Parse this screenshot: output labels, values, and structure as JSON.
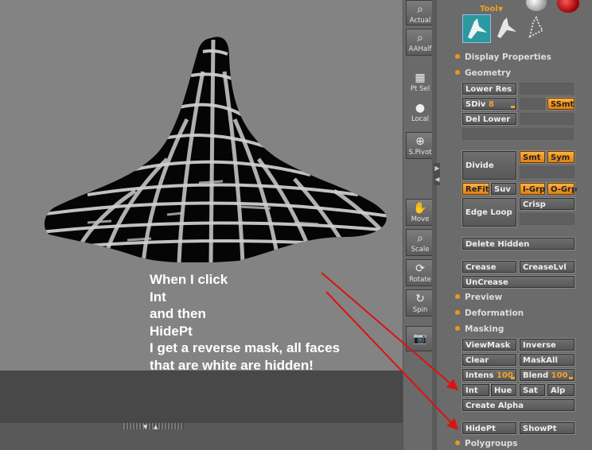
{
  "toolbar": {
    "items": [
      {
        "label": "Actual",
        "icon": "magnifier-icon"
      },
      {
        "label": "AAHalf",
        "icon": "magnifier-half-icon"
      },
      {
        "label": "Pt Sel",
        "icon": "grid-icon"
      },
      {
        "label": "Local",
        "icon": "local-sphere-icon"
      },
      {
        "label": "S.Pivot",
        "icon": "pivot-icon"
      },
      {
        "label": "Move",
        "icon": "hand-icon"
      },
      {
        "label": "Scale",
        "icon": "scale-icon"
      },
      {
        "label": "Rotate",
        "icon": "rotate-icon"
      },
      {
        "label": "Spin",
        "icon": "spin-icon"
      },
      {
        "label": "",
        "icon": "camera-icon"
      }
    ]
  },
  "tool": {
    "label": "Tool"
  },
  "sections": {
    "display": "Display Properties",
    "geometry": "Geometry",
    "preview": "Preview",
    "deformation": "Deformation",
    "masking": "Masking",
    "polygroups": "Polygroups"
  },
  "geometry": {
    "lower_res": "Lower Res",
    "sdiv_label": "SDiv",
    "sdiv_value": "8",
    "ssmt": "SSmt",
    "del_lower": "Del Lower",
    "divide": "Divide",
    "smt": "Smt",
    "sym": "Sym",
    "refit": "ReFit",
    "suv": "Suv",
    "igrp": "I-Grp",
    "ogrp": "O-Grp",
    "edge_loop": "Edge Loop",
    "crisp": "Crisp",
    "delete_hidden": "Delete Hidden",
    "crease": "Crease",
    "creaselvl": "CreaseLvl",
    "uncrease": "UnCrease"
  },
  "masking": {
    "viewmask": "ViewMask",
    "inverse": "Inverse",
    "clear": "Clear",
    "maskall": "MaskAll",
    "intens_label": "Intens",
    "intens_value": "100",
    "blend_label": "Blend",
    "blend_value": "100",
    "int": "Int",
    "hue": "Hue",
    "sat": "Sat",
    "alp": "Alp",
    "create_alpha": "Create Alpha",
    "hidept": "HidePt",
    "showpt": "ShowPt"
  },
  "annotation": {
    "lines": [
      "When I click",
      "Int",
      "and then",
      "HidePt",
      "I get a reverse mask, all faces",
      "that are white are hidden!"
    ]
  },
  "colors": {
    "accent": "#e9981e",
    "arrow": "#dd1111",
    "canvas": "#838383"
  }
}
